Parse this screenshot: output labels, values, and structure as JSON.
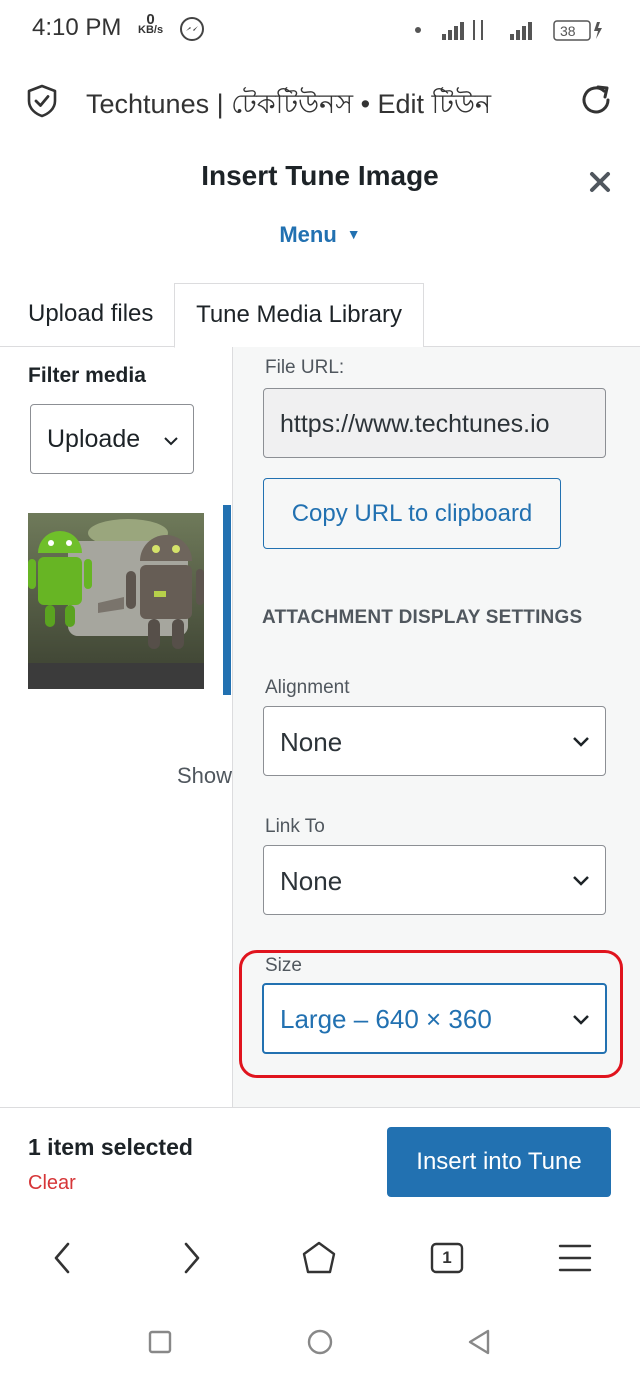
{
  "status_bar": {
    "time": "4:10 PM",
    "speed_value": "0",
    "speed_unit": "KB/s",
    "battery": "38"
  },
  "browser": {
    "page_title": "Techtunes | টেকটিউনস • Edit টিউন",
    "tab_count": "1"
  },
  "modal": {
    "title": "Insert Tune Image",
    "menu_label": "Menu"
  },
  "tabs": [
    {
      "label": "Upload files"
    },
    {
      "label": "Tune Media Library",
      "active": true
    }
  ],
  "filter": {
    "label": "Filter media",
    "selected": "Uploade"
  },
  "library": {
    "show_text": "Show"
  },
  "attachment": {
    "file_url_label": "File URL:",
    "file_url_value": "https://www.techtunes.io",
    "copy_button": "Copy URL to clipboard",
    "display_settings_heading": "ATTACHMENT DISPLAY SETTINGS",
    "alignment_label": "Alignment",
    "alignment_value": "None",
    "link_to_label": "Link To",
    "link_to_value": "None",
    "size_label": "Size",
    "size_value": "Large – 640 × 360"
  },
  "footer": {
    "selected_count": "1 item selected",
    "clear_label": "Clear",
    "insert_button": "Insert into Tune"
  },
  "colors": {
    "accent": "#2271b1",
    "danger": "#d63638",
    "highlight": "#e0141e"
  },
  "icons": [
    "messenger-icon",
    "shield-check-icon",
    "reload-icon",
    "close-icon",
    "chevron-down-icon",
    "back-icon",
    "forward-icon",
    "home-icon",
    "tabs-icon",
    "menu-icon",
    "square-icon",
    "circle-icon",
    "triangle-back-icon"
  ]
}
